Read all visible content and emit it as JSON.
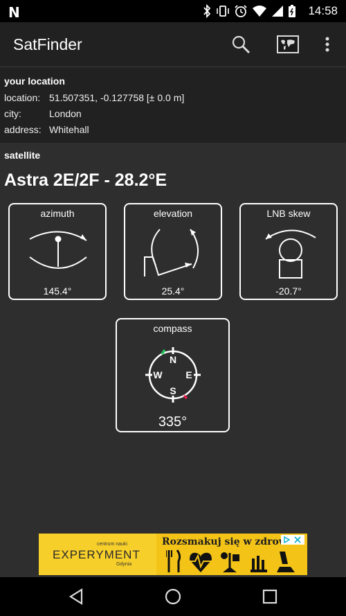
{
  "status_bar": {
    "time": "14:58",
    "icons": [
      "notification-n-icon",
      "bluetooth-icon",
      "vibrate-icon",
      "alarm-icon",
      "wifi-icon",
      "signal-icon",
      "battery-icon"
    ]
  },
  "app_bar": {
    "title": "SatFinder",
    "actions": [
      "search-icon",
      "map-icon",
      "more-vert-icon"
    ]
  },
  "location": {
    "header": "your location",
    "rows": [
      {
        "label": "location:",
        "value": "51.507351, -0.127758 [± 0.0 m]"
      },
      {
        "label": "city:",
        "value": "London"
      },
      {
        "label": "address:",
        "value": "Whitehall"
      }
    ]
  },
  "satellite": {
    "header": "satellite",
    "name": "Astra 2E/2F - 28.2°E",
    "azimuth": {
      "label": "azimuth",
      "value": "145.4°"
    },
    "elevation": {
      "label": "elevation",
      "value": "25.4°"
    },
    "lnb_skew": {
      "label": "LNB skew",
      "value": "-20.7°"
    },
    "compass": {
      "label": "compass",
      "value": "335°",
      "directions": {
        "n": "N",
        "e": "E",
        "s": "S",
        "w": "W"
      }
    }
  },
  "ad": {
    "small_text": "centrum nauki",
    "brand": "EXPERYMENT",
    "city": "Gdynia",
    "headline": "Rozsmakuj się w zdrow"
  },
  "nav_bar": {
    "buttons": [
      "back-icon",
      "home-icon",
      "recents-icon"
    ]
  },
  "colors": {
    "background": "#2e2e2e",
    "app_bar": "#212121",
    "ad_yellow": "#f4c318",
    "compass_north_marker": "#22c55e",
    "compass_south_marker": "#e11d48"
  }
}
